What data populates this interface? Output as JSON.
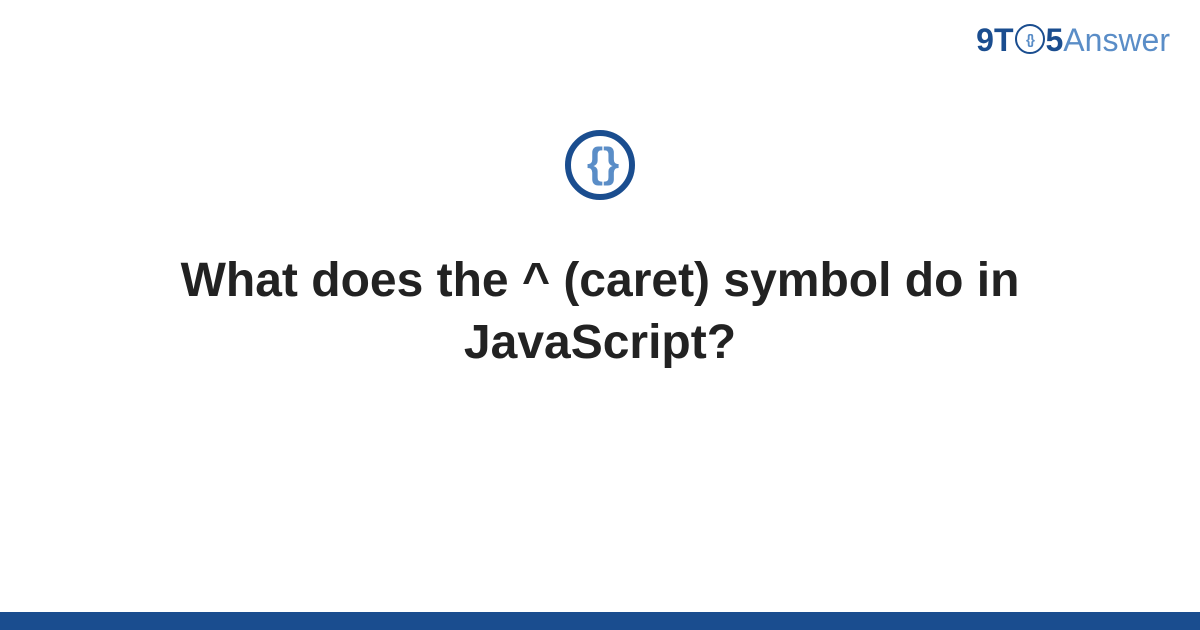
{
  "logo": {
    "part1": "9T",
    "circle_inner": "{}",
    "part2": "5",
    "part3": "Answer"
  },
  "icon": {
    "braces": "{ }",
    "semantic": "code-braces-icon"
  },
  "title": "What does the ^ (caret) symbol do in JavaScript?",
  "colors": {
    "brand_dark": "#1a4d8f",
    "brand_light": "#5a8dc7",
    "text": "#222222",
    "background": "#ffffff"
  }
}
